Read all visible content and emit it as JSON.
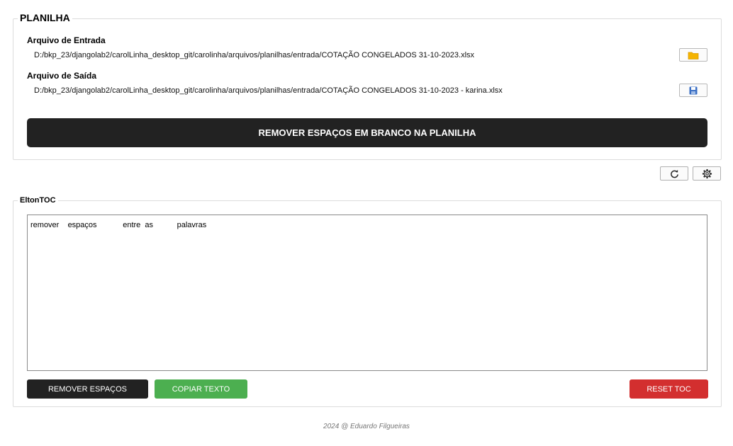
{
  "planilha": {
    "title": "PLANILHA",
    "input_label": "Arquivo de Entrada",
    "input_path": "D:/bkp_23/djangolab2/carolLinha_desktop_git/carolinha/arquivos/planilhas/entrada/COTAÇÃO CONGELADOS 31-10-2023.xlsx",
    "output_label": "Arquivo de Saída",
    "output_path": "D:/bkp_23/djangolab2/carolLinha_desktop_git/carolinha/arquivos/planilhas/entrada/COTAÇÃO CONGELADOS 31-10-2023 - karina.xlsx",
    "remove_button": "REMOVER ESPAÇOS EM BRANCO NA PLANILHA",
    "icons": {
      "open": "folder-icon",
      "save": "save-icon"
    }
  },
  "toolbar": {
    "icons": [
      "refresh-icon",
      "gear-icon"
    ]
  },
  "elton": {
    "title": "EltonTOC",
    "text": "remover    espaços            entre  as           palavras",
    "remove_button": "REMOVER ESPAÇOS",
    "copy_button": "COPIAR TEXTO",
    "reset_button": "RESET TOC"
  },
  "colors": {
    "dark": "#222222",
    "green": "#4caf50",
    "red": "#d32f2f",
    "folder": "#f5b400",
    "save": "#3b6fc4"
  },
  "footer": "2024 @ Eduardo Filgueiras"
}
